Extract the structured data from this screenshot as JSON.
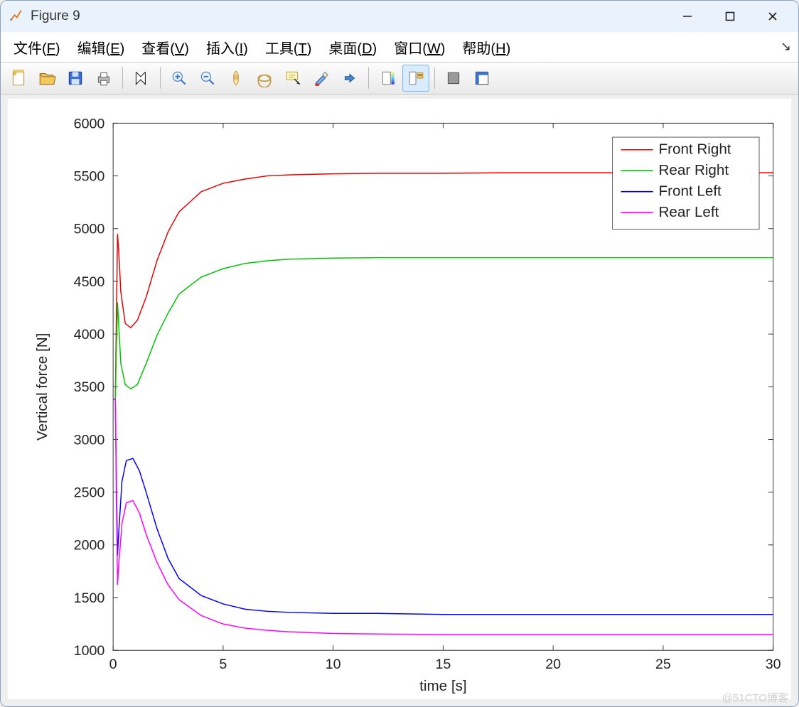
{
  "window": {
    "title": "Figure 9"
  },
  "menu": {
    "items": [
      {
        "label": "文件",
        "accel": "F"
      },
      {
        "label": "编辑",
        "accel": "E"
      },
      {
        "label": "查看",
        "accel": "V"
      },
      {
        "label": "插入",
        "accel": "I"
      },
      {
        "label": "工具",
        "accel": "T"
      },
      {
        "label": "桌面",
        "accel": "D"
      },
      {
        "label": "窗口",
        "accel": "W"
      },
      {
        "label": "帮助",
        "accel": "H"
      }
    ]
  },
  "toolbar": {
    "buttons": [
      {
        "id": "new-figure-icon"
      },
      {
        "id": "open-file-icon"
      },
      {
        "id": "save-icon"
      },
      {
        "id": "print-icon"
      },
      {
        "sep": true
      },
      {
        "id": "edit-plot-icon"
      },
      {
        "sep": true
      },
      {
        "id": "zoom-in-icon"
      },
      {
        "id": "zoom-out-icon"
      },
      {
        "id": "pan-icon"
      },
      {
        "id": "rotate-3d-icon"
      },
      {
        "id": "data-cursor-icon"
      },
      {
        "id": "brush-icon"
      },
      {
        "id": "link-plots-icon"
      },
      {
        "sep": true
      },
      {
        "id": "colorbar-icon"
      },
      {
        "id": "legend-icon",
        "active": true
      },
      {
        "sep": true
      },
      {
        "id": "hide-plot-tools-icon"
      },
      {
        "id": "show-plot-tools-icon"
      }
    ]
  },
  "watermark": "@51CTO博客",
  "chart_data": {
    "type": "line",
    "xlabel": "time [s]",
    "ylabel": "Vertical force [N]",
    "xlim": [
      0,
      30
    ],
    "ylim": [
      1000,
      6000
    ],
    "xticks": [
      0,
      5,
      10,
      15,
      20,
      25,
      30
    ],
    "yticks": [
      1000,
      1500,
      2000,
      2500,
      3000,
      3500,
      4000,
      4500,
      5000,
      5500,
      6000
    ],
    "legend": {
      "position": "northeast",
      "entries": [
        "Front Right",
        "Rear Right",
        "Front Left",
        "Rear Left"
      ]
    },
    "colors": {
      "Front Right": "#e60000",
      "Rear Right": "#00c400",
      "Front Left": "#0000ff",
      "Rear Left": "#ff00ff"
    },
    "series": [
      {
        "name": "Front Right",
        "x": [
          0,
          0.1,
          0.15,
          0.2,
          0.25,
          0.35,
          0.55,
          0.8,
          1.1,
          1.5,
          2,
          2.5,
          3,
          4,
          5,
          6,
          7,
          8,
          10,
          12,
          15,
          18,
          20,
          25,
          30
        ],
        "y": [
          3380,
          3380,
          4200,
          4950,
          4800,
          4400,
          4100,
          4060,
          4130,
          4350,
          4700,
          4970,
          5160,
          5350,
          5430,
          5470,
          5500,
          5510,
          5520,
          5525,
          5525,
          5530,
          5530,
          5530,
          5530
        ]
      },
      {
        "name": "Rear Right",
        "x": [
          0,
          0.1,
          0.15,
          0.2,
          0.25,
          0.35,
          0.55,
          0.8,
          1.1,
          1.5,
          2,
          2.5,
          3,
          4,
          5,
          6,
          7,
          8,
          10,
          12,
          15,
          18,
          20,
          25,
          30
        ],
        "y": [
          3380,
          3380,
          3900,
          4300,
          4100,
          3720,
          3520,
          3480,
          3520,
          3720,
          3990,
          4200,
          4380,
          4540,
          4620,
          4670,
          4695,
          4710,
          4720,
          4725,
          4725,
          4725,
          4725,
          4725,
          4725
        ]
      },
      {
        "name": "Front Left",
        "x": [
          0,
          0.1,
          0.15,
          0.2,
          0.25,
          0.4,
          0.6,
          0.9,
          1.2,
          1.5,
          2,
          2.5,
          3,
          4,
          5,
          6,
          7,
          8,
          10,
          12,
          15,
          18,
          20,
          25,
          30
        ],
        "y": [
          3380,
          3380,
          2600,
          1900,
          2100,
          2600,
          2800,
          2820,
          2700,
          2500,
          2150,
          1870,
          1680,
          1520,
          1440,
          1390,
          1370,
          1360,
          1350,
          1350,
          1340,
          1340,
          1340,
          1340,
          1340
        ]
      },
      {
        "name": "Rear Left",
        "x": [
          0,
          0.1,
          0.15,
          0.2,
          0.25,
          0.4,
          0.6,
          0.9,
          1.2,
          1.5,
          2,
          2.5,
          3,
          4,
          5,
          6,
          7,
          8,
          10,
          12,
          15,
          18,
          20,
          25,
          30
        ],
        "y": [
          3380,
          3380,
          2400,
          1620,
          1800,
          2200,
          2400,
          2420,
          2300,
          2100,
          1830,
          1620,
          1480,
          1330,
          1250,
          1210,
          1190,
          1175,
          1160,
          1155,
          1150,
          1150,
          1150,
          1150,
          1150
        ]
      }
    ]
  }
}
